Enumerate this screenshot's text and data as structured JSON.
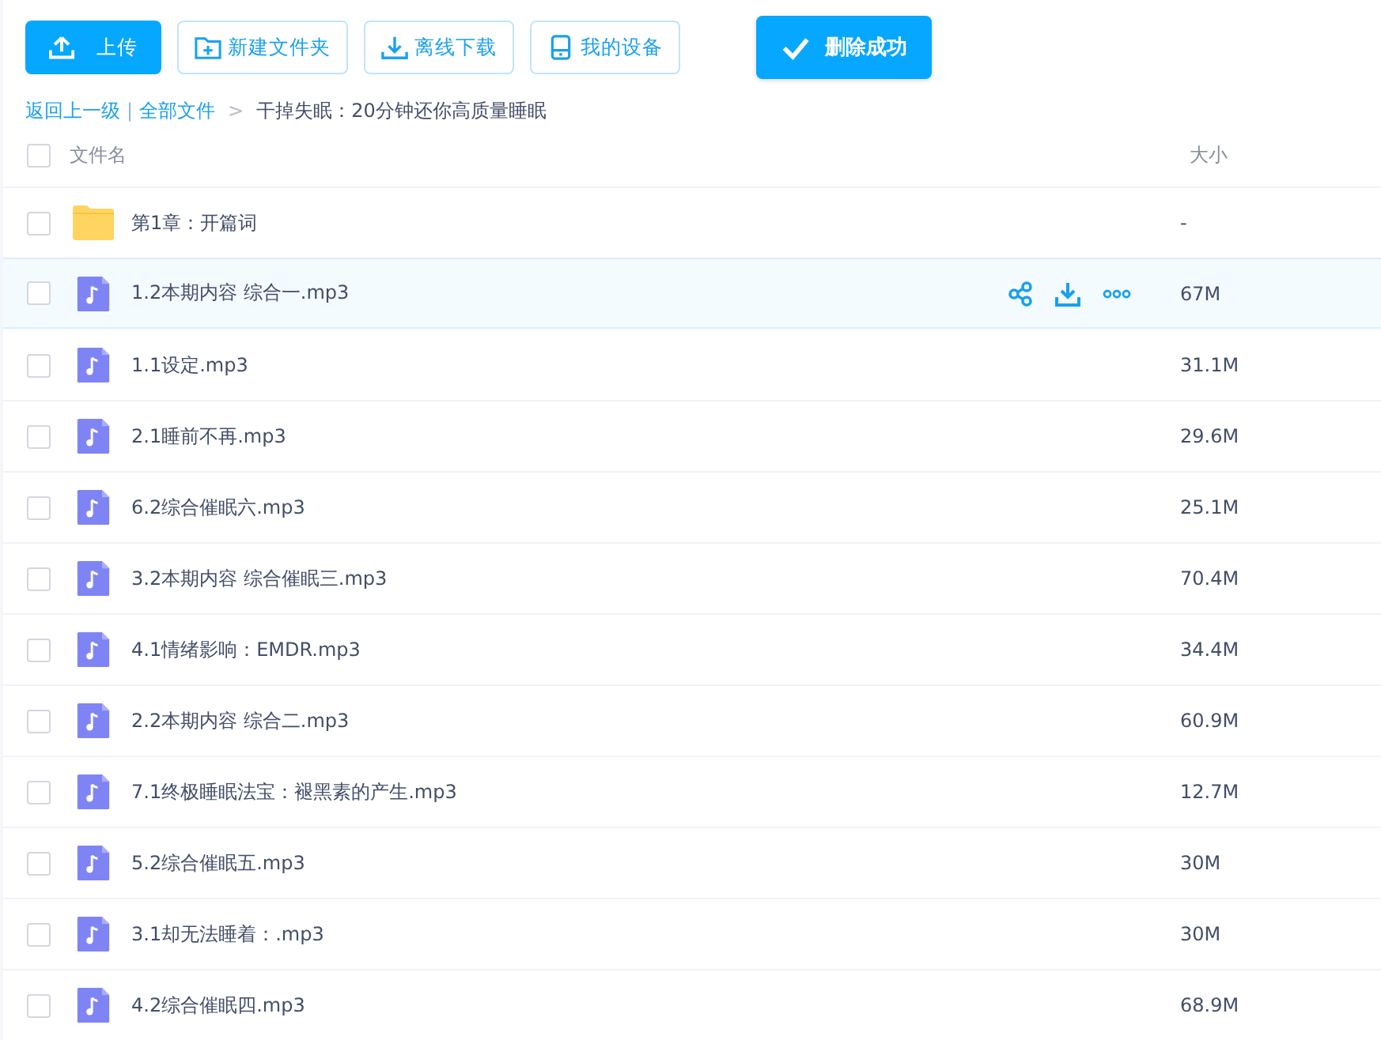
{
  "toolbar": [
    {
      "kind": "upload",
      "label": "上传",
      "primary": true
    },
    {
      "kind": "new-folder",
      "label": "新建文件夹",
      "primary": false
    },
    {
      "kind": "offline-download",
      "label": "离线下载",
      "primary": false
    },
    {
      "kind": "device",
      "label": "我的设备",
      "primary": false
    }
  ],
  "toast": {
    "text": "删除成功"
  },
  "breadcrumb": {
    "back": "返回上一级",
    "divider": "|",
    "root": "全部文件",
    "arrow": ">",
    "current": "干掉失眠：20分钟还你高质量睡眠"
  },
  "table": {
    "columns": [
      "文件名",
      "大小"
    ],
    "header_checked": false,
    "rows": [
      {
        "kind": "folder",
        "name": "第1章：开篇词",
        "size": "-",
        "checked": false,
        "hovered": false
      },
      {
        "kind": "audio",
        "name": "1.2本期内容 综合一.mp3",
        "size": "67M",
        "checked": false,
        "hovered": true
      },
      {
        "kind": "audio",
        "name": "1.1设定.mp3",
        "size": "31.1M",
        "checked": false,
        "hovered": false
      },
      {
        "kind": "audio",
        "name": "2.1睡前不再.mp3",
        "size": "29.6M",
        "checked": false,
        "hovered": false
      },
      {
        "kind": "audio",
        "name": "6.2综合催眠六.mp3",
        "size": "25.1M",
        "checked": false,
        "hovered": false
      },
      {
        "kind": "audio",
        "name": "3.2本期内容 综合催眠三.mp3",
        "size": "70.4M",
        "checked": false,
        "hovered": false
      },
      {
        "kind": "audio",
        "name": "4.1情绪影响：EMDR.mp3",
        "size": "34.4M",
        "checked": false,
        "hovered": false
      },
      {
        "kind": "audio",
        "name": "2.2本期内容 综合二.mp3",
        "size": "60.9M",
        "checked": false,
        "hovered": false
      },
      {
        "kind": "audio",
        "name": "7.1终极睡眠法宝：褪黑素的产生.mp3",
        "size": "12.7M",
        "checked": false,
        "hovered": false
      },
      {
        "kind": "audio",
        "name": "5.2综合催眠五.mp3",
        "size": "30M",
        "checked": false,
        "hovered": false
      },
      {
        "kind": "audio",
        "name": "3.1却无法睡着：.mp3",
        "size": "30M",
        "checked": false,
        "hovered": false
      },
      {
        "kind": "audio",
        "name": "4.2综合催眠四.mp3",
        "size": "68.9M",
        "checked": false,
        "hovered": false
      }
    ]
  }
}
